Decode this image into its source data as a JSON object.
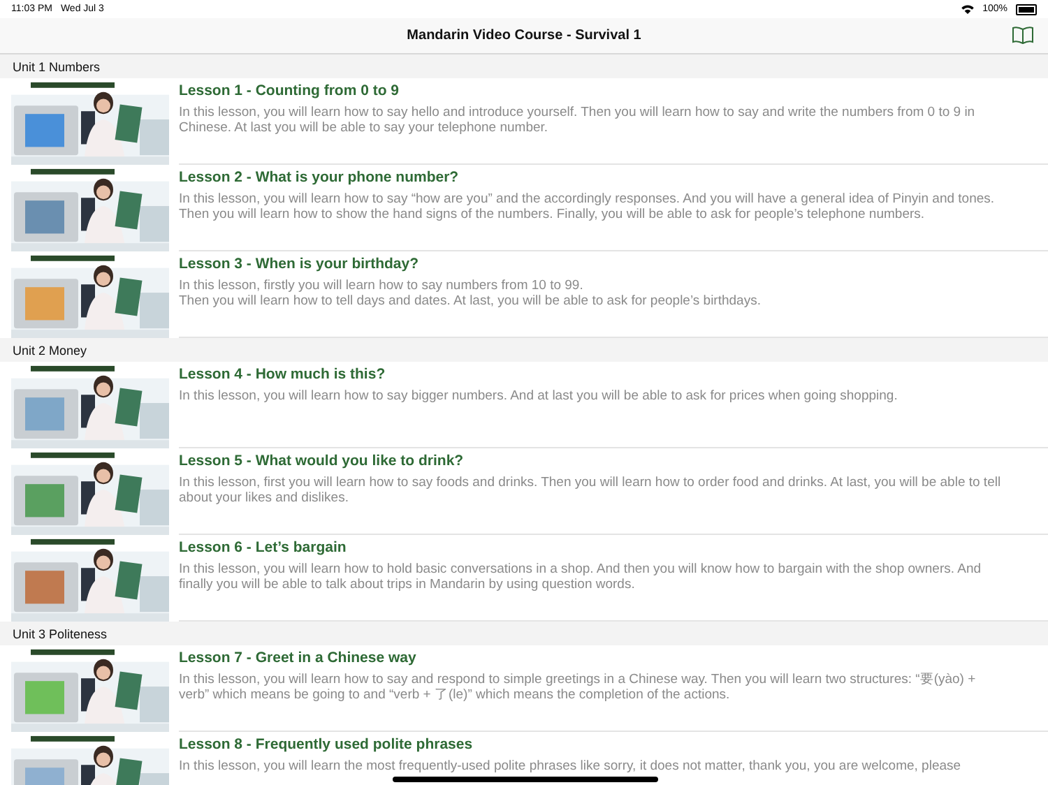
{
  "status_bar": {
    "time": "11:03 PM",
    "date": "Wed Jul 3",
    "battery_text": "100%"
  },
  "nav": {
    "title": "Mandarin Video Course - Survival 1"
  },
  "units": [
    {
      "title": "Unit 1 Numbers",
      "lessons": [
        {
          "title": "Lesson 1 - Counting from 0 to 9",
          "description": "In this lesson, you will learn how to say hello and introduce yourself. Then you will learn how to say and write the numbers from 0 to 9 in Chinese. At last you will be able to say your telephone number."
        },
        {
          "title": "Lesson 2 - What is your phone number?",
          "description": "In this lesson, you will learn how to say “how are you” and the accordingly responses. And you will have a general idea of Pinyin and tones. Then you will learn how to show the hand signs of the numbers. Finally, you will be able to ask for people’s telephone numbers."
        },
        {
          "title": "Lesson 3 - When is your birthday?",
          "description": "In this lesson, firstly you will learn how to say numbers from 10 to 99.\nThen you will learn how to tell days and dates. At last, you will be able to ask for people’s birthdays."
        }
      ]
    },
    {
      "title": "Unit 2 Money",
      "lessons": [
        {
          "title": "Lesson 4 - How much is this?",
          "description": "In this lesson, you will learn how to say bigger numbers. And at last you will be able to ask for prices when going shopping."
        },
        {
          "title": "Lesson 5 - What would you like to drink?",
          "description": "In this lesson, first you will learn how to say foods and drinks. Then you will learn how to order food and drinks. At last, you will be able to tell about your likes and dislikes."
        },
        {
          "title": "Lesson 6 - Let’s bargain",
          "description": "In this lesson, you will learn how to hold basic conversations in a shop. And then you will know how to bargain with the shop owners. And finally you will be able to talk about trips in Mandarin by using question words."
        }
      ]
    },
    {
      "title": "Unit 3 Politeness",
      "lessons": [
        {
          "title": "Lesson 7 - Greet in a Chinese way",
          "description": "In this lesson, you will learn how to say and respond to simple greetings in a Chinese way. Then you will learn two structures: “要(yào) + verb”  which means be going to and “verb + 了(le)” which means the completion of the actions."
        },
        {
          "title": "Lesson 8 - Frequently used polite phrases",
          "description": "In this lesson, you will learn the most frequently-used polite phrases like sorry, it does not matter, thank you, you are welcome, please"
        }
      ]
    }
  ]
}
